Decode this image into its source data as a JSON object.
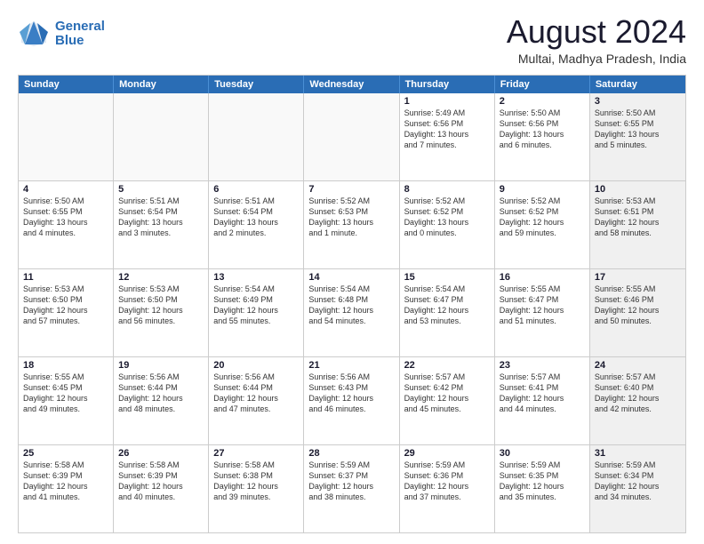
{
  "logo": {
    "line1": "General",
    "line2": "Blue"
  },
  "title": "August 2024",
  "subtitle": "Multai, Madhya Pradesh, India",
  "days": [
    "Sunday",
    "Monday",
    "Tuesday",
    "Wednesday",
    "Thursday",
    "Friday",
    "Saturday"
  ],
  "rows": [
    [
      {
        "day": "",
        "info": "",
        "empty": true
      },
      {
        "day": "",
        "info": "",
        "empty": true
      },
      {
        "day": "",
        "info": "",
        "empty": true
      },
      {
        "day": "",
        "info": "",
        "empty": true
      },
      {
        "day": "1",
        "info": "Sunrise: 5:49 AM\nSunset: 6:56 PM\nDaylight: 13 hours\nand 7 minutes."
      },
      {
        "day": "2",
        "info": "Sunrise: 5:50 AM\nSunset: 6:56 PM\nDaylight: 13 hours\nand 6 minutes."
      },
      {
        "day": "3",
        "info": "Sunrise: 5:50 AM\nSunset: 6:55 PM\nDaylight: 13 hours\nand 5 minutes.",
        "shaded": true
      }
    ],
    [
      {
        "day": "4",
        "info": "Sunrise: 5:50 AM\nSunset: 6:55 PM\nDaylight: 13 hours\nand 4 minutes."
      },
      {
        "day": "5",
        "info": "Sunrise: 5:51 AM\nSunset: 6:54 PM\nDaylight: 13 hours\nand 3 minutes."
      },
      {
        "day": "6",
        "info": "Sunrise: 5:51 AM\nSunset: 6:54 PM\nDaylight: 13 hours\nand 2 minutes."
      },
      {
        "day": "7",
        "info": "Sunrise: 5:52 AM\nSunset: 6:53 PM\nDaylight: 13 hours\nand 1 minute."
      },
      {
        "day": "8",
        "info": "Sunrise: 5:52 AM\nSunset: 6:52 PM\nDaylight: 13 hours\nand 0 minutes."
      },
      {
        "day": "9",
        "info": "Sunrise: 5:52 AM\nSunset: 6:52 PM\nDaylight: 12 hours\nand 59 minutes."
      },
      {
        "day": "10",
        "info": "Sunrise: 5:53 AM\nSunset: 6:51 PM\nDaylight: 12 hours\nand 58 minutes.",
        "shaded": true
      }
    ],
    [
      {
        "day": "11",
        "info": "Sunrise: 5:53 AM\nSunset: 6:50 PM\nDaylight: 12 hours\nand 57 minutes."
      },
      {
        "day": "12",
        "info": "Sunrise: 5:53 AM\nSunset: 6:50 PM\nDaylight: 12 hours\nand 56 minutes."
      },
      {
        "day": "13",
        "info": "Sunrise: 5:54 AM\nSunset: 6:49 PM\nDaylight: 12 hours\nand 55 minutes."
      },
      {
        "day": "14",
        "info": "Sunrise: 5:54 AM\nSunset: 6:48 PM\nDaylight: 12 hours\nand 54 minutes."
      },
      {
        "day": "15",
        "info": "Sunrise: 5:54 AM\nSunset: 6:47 PM\nDaylight: 12 hours\nand 53 minutes."
      },
      {
        "day": "16",
        "info": "Sunrise: 5:55 AM\nSunset: 6:47 PM\nDaylight: 12 hours\nand 51 minutes."
      },
      {
        "day": "17",
        "info": "Sunrise: 5:55 AM\nSunset: 6:46 PM\nDaylight: 12 hours\nand 50 minutes.",
        "shaded": true
      }
    ],
    [
      {
        "day": "18",
        "info": "Sunrise: 5:55 AM\nSunset: 6:45 PM\nDaylight: 12 hours\nand 49 minutes."
      },
      {
        "day": "19",
        "info": "Sunrise: 5:56 AM\nSunset: 6:44 PM\nDaylight: 12 hours\nand 48 minutes."
      },
      {
        "day": "20",
        "info": "Sunrise: 5:56 AM\nSunset: 6:44 PM\nDaylight: 12 hours\nand 47 minutes."
      },
      {
        "day": "21",
        "info": "Sunrise: 5:56 AM\nSunset: 6:43 PM\nDaylight: 12 hours\nand 46 minutes."
      },
      {
        "day": "22",
        "info": "Sunrise: 5:57 AM\nSunset: 6:42 PM\nDaylight: 12 hours\nand 45 minutes."
      },
      {
        "day": "23",
        "info": "Sunrise: 5:57 AM\nSunset: 6:41 PM\nDaylight: 12 hours\nand 44 minutes."
      },
      {
        "day": "24",
        "info": "Sunrise: 5:57 AM\nSunset: 6:40 PM\nDaylight: 12 hours\nand 42 minutes.",
        "shaded": true
      }
    ],
    [
      {
        "day": "25",
        "info": "Sunrise: 5:58 AM\nSunset: 6:39 PM\nDaylight: 12 hours\nand 41 minutes."
      },
      {
        "day": "26",
        "info": "Sunrise: 5:58 AM\nSunset: 6:39 PM\nDaylight: 12 hours\nand 40 minutes."
      },
      {
        "day": "27",
        "info": "Sunrise: 5:58 AM\nSunset: 6:38 PM\nDaylight: 12 hours\nand 39 minutes."
      },
      {
        "day": "28",
        "info": "Sunrise: 5:59 AM\nSunset: 6:37 PM\nDaylight: 12 hours\nand 38 minutes."
      },
      {
        "day": "29",
        "info": "Sunrise: 5:59 AM\nSunset: 6:36 PM\nDaylight: 12 hours\nand 37 minutes."
      },
      {
        "day": "30",
        "info": "Sunrise: 5:59 AM\nSunset: 6:35 PM\nDaylight: 12 hours\nand 35 minutes."
      },
      {
        "day": "31",
        "info": "Sunrise: 5:59 AM\nSunset: 6:34 PM\nDaylight: 12 hours\nand 34 minutes.",
        "shaded": true
      }
    ]
  ]
}
